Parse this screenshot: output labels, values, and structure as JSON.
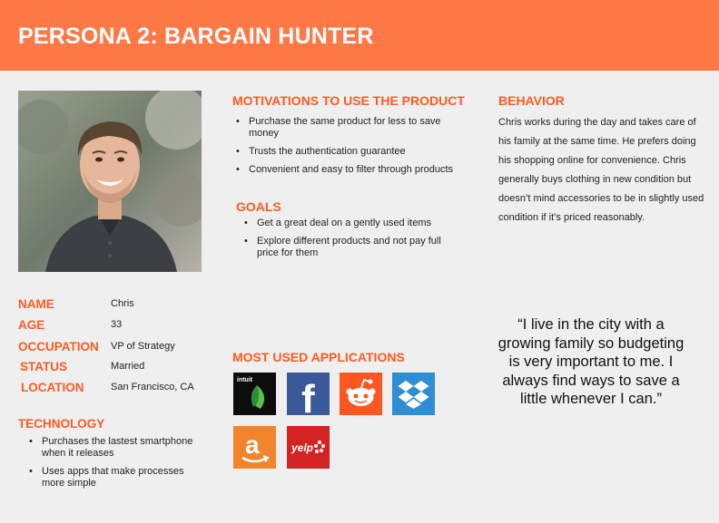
{
  "header": {
    "title": "PERSONA 2: BARGAIN HUNTER"
  },
  "colors": {
    "accent": "#ff7846",
    "heading": "#ff5a1f",
    "background": "#efefef"
  },
  "motivations": {
    "title": "MOTIVATIONS TO USE THE PRODUCT",
    "items": [
      "Purchase the same product for less to save money",
      "Trusts the authentication guarantee",
      "Convenient and easy to filter through products"
    ]
  },
  "goals": {
    "title": "GOALS",
    "items": [
      "Get a great deal on a gently used items",
      "Explore different products and not pay full price for them"
    ]
  },
  "behavior": {
    "title": "BEHAVIOR",
    "text": "Chris works during the day and takes care of his family at the same time. He prefers doing his shopping online for convenience. Chris generally buys clothing in new condition but doesn’t mind accessories to be in slightly used condition if it’s priced reasonably."
  },
  "profile": {
    "name_label": "NAME",
    "name": "Chris",
    "age_label": "AGE",
    "age": "33",
    "occupation_label": "OCCUPATION",
    "occupation": "VP of Strategy",
    "status_label": "STATUS",
    "status": "Married",
    "location_label": "LOCATION",
    "location": "San Francisco, CA"
  },
  "technology": {
    "title": "TECHNOLOGY",
    "items": [
      "Purchases the lastest smartphone when it releases",
      "Uses apps that make processes more simple"
    ]
  },
  "apps": {
    "title": "MOST USED APPLICATIONS",
    "mint_label": "intuit",
    "facebook_label": "f",
    "amazon_label": "a",
    "yelp_label": "yelp",
    "icons": [
      "mint-icon",
      "facebook-icon",
      "reddit-icon",
      "dropbox-icon",
      "amazon-icon",
      "yelp-icon"
    ]
  },
  "quote": {
    "text": "“I live in the city with a growing family so budgeting is very important to me. I always find ways to save a little whenever I can.”"
  }
}
